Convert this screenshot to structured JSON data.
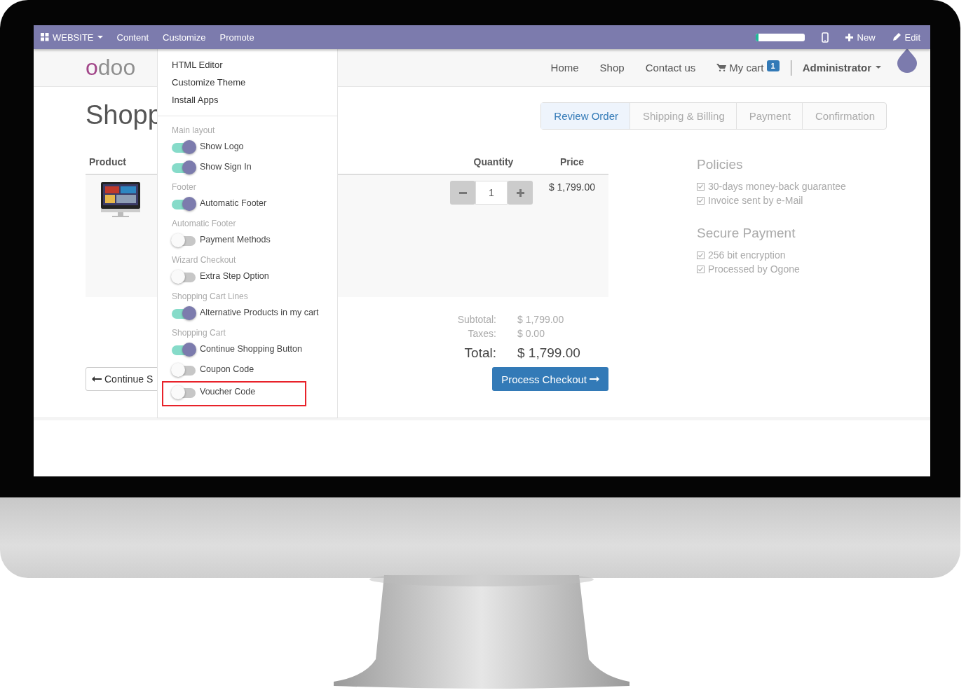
{
  "topbar": {
    "brand": "WEBSITE",
    "menus": [
      "Content",
      "Customize",
      "Promote"
    ],
    "progress": {
      "level": 0.07
    },
    "actions": [
      {
        "kind": "new",
        "label": "New"
      },
      {
        "kind": "edit",
        "label": "Edit"
      }
    ]
  },
  "header": {
    "logo": "odoo",
    "nav": [
      "Home",
      "Shop",
      "Contact us"
    ],
    "cart": {
      "label": "My cart",
      "count": "1"
    },
    "user": "Administrator"
  },
  "page": {
    "title": "Shopp",
    "steps": [
      {
        "label": "Review Order",
        "selected": true
      },
      {
        "label": "Shipping & Billing",
        "selected": false
      },
      {
        "label": "Payment",
        "selected": false
      },
      {
        "label": "Confirmation",
        "selected": false
      }
    ]
  },
  "cart": {
    "columns": [
      "Product",
      "Quantity",
      "Price"
    ],
    "rows": [
      {
        "quantity": "1",
        "price": "$ 1,799.00"
      }
    ],
    "totals": [
      {
        "kind": "minor",
        "label": "Subtotal:",
        "value": "$ 1,799.00"
      },
      {
        "kind": "minor",
        "label": "Taxes:",
        "value": "$ 0.00"
      },
      {
        "kind": "total",
        "label": "Total:",
        "value": "$ 1,799.00"
      }
    ],
    "continue_button": "Continue S",
    "checkout_button": "Process Checkout"
  },
  "sidebar": [
    {
      "heading": "Policies",
      "items": [
        "30-days money-back guarantee",
        "Invoice sent by e-Mail"
      ]
    },
    {
      "heading": "Secure Payment",
      "items": [
        "256 bit encryption",
        "Processed by Ogone"
      ]
    }
  ],
  "dropdown": {
    "links": [
      "HTML Editor",
      "Customize Theme",
      "Install Apps"
    ],
    "sections": [
      {
        "heading": "Main layout",
        "options": [
          {
            "label": "Show Logo",
            "on": true,
            "highlighted": false
          },
          {
            "label": "Show Sign In",
            "on": true,
            "highlighted": false
          }
        ]
      },
      {
        "heading": "Footer",
        "options": [
          {
            "label": "Automatic Footer",
            "on": true,
            "highlighted": false
          }
        ]
      },
      {
        "heading": "Automatic Footer",
        "options": [
          {
            "label": "Payment Methods",
            "on": false,
            "highlighted": false
          }
        ]
      },
      {
        "heading": "Wizard Checkout",
        "options": [
          {
            "label": "Extra Step Option",
            "on": false,
            "highlighted": false
          }
        ]
      },
      {
        "heading": "Shopping Cart Lines",
        "options": [
          {
            "label": "Alternative Products in my cart",
            "on": true,
            "highlighted": false
          }
        ]
      },
      {
        "heading": "Shopping Cart",
        "options": [
          {
            "label": "Continue Shopping Button",
            "on": true,
            "highlighted": false
          },
          {
            "label": "Coupon Code",
            "on": false,
            "highlighted": false
          },
          {
            "label": "Voucher Code",
            "on": false,
            "highlighted": true
          }
        ]
      }
    ]
  }
}
